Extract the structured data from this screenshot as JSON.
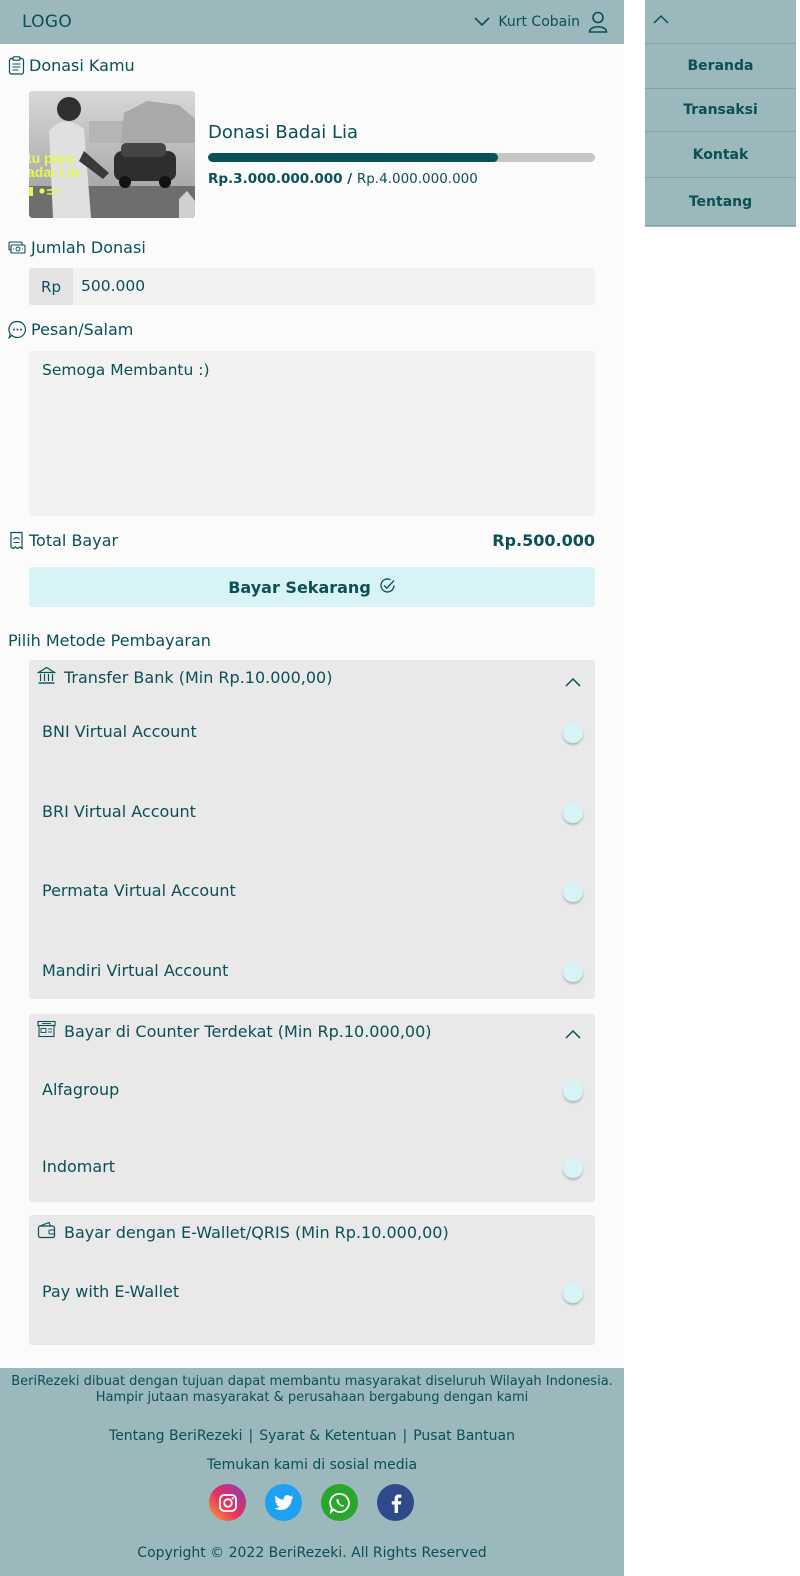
{
  "header": {
    "logo": "LOGO",
    "user_name": "Kurt Cobain"
  },
  "sidebar": {
    "items": [
      "Beranda",
      "Transaksi",
      "Kontak",
      "Tentang"
    ]
  },
  "donation": {
    "section_title": "Donasi Kamu",
    "thumbnail_text": "tu para\nadai Lia.",
    "campaign_name": "Donasi Badai Lia",
    "collected": "Rp.3.000.000.000",
    "separator": " / ",
    "target": "Rp.4.000.000.000",
    "progress_fraction": 0.75
  },
  "amount": {
    "label": "Jumlah Donasi",
    "prefix": "Rp",
    "value": "500.000"
  },
  "message": {
    "label": "Pesan/Salam",
    "value": "Semoga Membantu :)"
  },
  "total": {
    "label": "Total Bayar",
    "value": "Rp.500.000"
  },
  "pay_button": "Bayar Sekarang",
  "payment": {
    "heading": "Pilih Metode Pembayaran",
    "groups": [
      {
        "title": "Transfer Bank (Min Rp.10.000,00)",
        "icon": "bank-icon",
        "options": [
          "BNI Virtual Account",
          "BRI Virtual Account",
          "Permata Virtual Account",
          "Mandiri Virtual Account"
        ]
      },
      {
        "title": "Bayar di Counter Terdekat (Min Rp.10.000,00)",
        "icon": "store-icon",
        "options": [
          "Alfagroup",
          "Indomart"
        ]
      },
      {
        "title": "Bayar dengan E-Wallet/QRIS (Min Rp.10.000,00)",
        "icon": "wallet-icon",
        "options": [
          "Pay with E-Wallet"
        ]
      }
    ]
  },
  "footer": {
    "about_line1": "BeriRezeki dibuat dengan tujuan dapat membantu masyarakat diseluruh Wilayah Indonesia.",
    "about_line2": "Hampir jutaan masyarakat & perusahaan bergabung dengan kami",
    "links": [
      "Tentang BeriRezeki",
      "Syarat & Ketentuan",
      "Pusat Bantuan"
    ],
    "link_separator": "|",
    "follow": "Temukan kami di sosial media",
    "copyright": "Copyright © 2022 BeriRezeki. All Rights Reserved"
  },
  "colors": {
    "accent": "#0b4f57",
    "header_bg": "#9bb8bc",
    "button_bg": "#d8f3f6",
    "card_bg": "#e9e9e9"
  }
}
